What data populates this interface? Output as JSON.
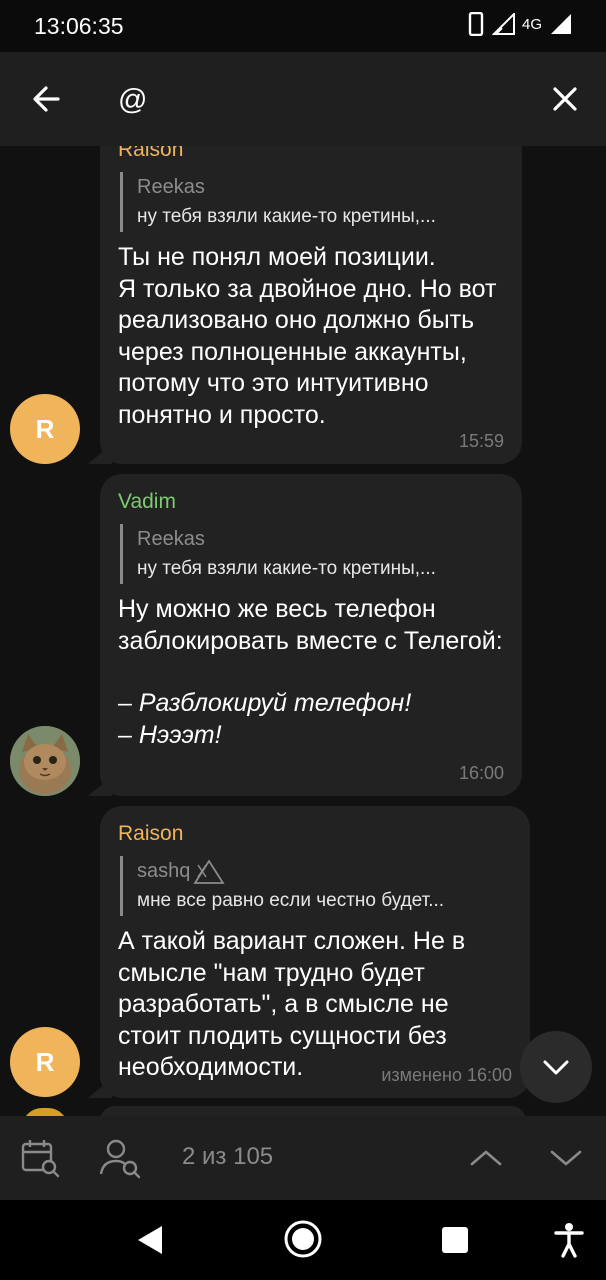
{
  "status": {
    "time": "13:06:35",
    "network": "4G"
  },
  "search": {
    "query": "@"
  },
  "messages": [
    {
      "sender": "Raison",
      "sender_color": "#f0b45a",
      "reply_to": "Reekas",
      "reply_text": "ну тебя взяли какие-то кретины,...",
      "text": "Ты не понял моей позиции.\nЯ только за двойное дно. Но вот реализовано оно должно быть через полноценные аккаунты, потому что это интуитивно понятно и просто.",
      "time": "15:59",
      "avatar_letter": "R",
      "avatar_color": "#f0b45a"
    },
    {
      "sender": "Vadim",
      "sender_color": "#7ccb6f",
      "reply_to": "Reekas",
      "reply_text": "ну тебя взяли какие-то кретины,...",
      "text": "Ну можно же весь телефон заблокировать вместе с Телегой:",
      "quote_lines": [
        "– Разблокируй телефон!",
        "– Нэээт!"
      ],
      "time": "16:00",
      "avatar_icon": "cat-avatar"
    },
    {
      "sender": "Raison",
      "sender_color": "#f0b45a",
      "reply_to": "sashq",
      "reply_text": "мне все равно если честно будет...",
      "text": "А такой вариант сложен. Не в смысле \"нам трудно будет разработать\", а в смысле не стоит плодить сущности без необходимости.",
      "time": "изменено 16:00",
      "avatar_letter": "R",
      "avatar_color": "#f0b45a"
    }
  ],
  "bottom_bar": {
    "counter": "2 из 105"
  }
}
